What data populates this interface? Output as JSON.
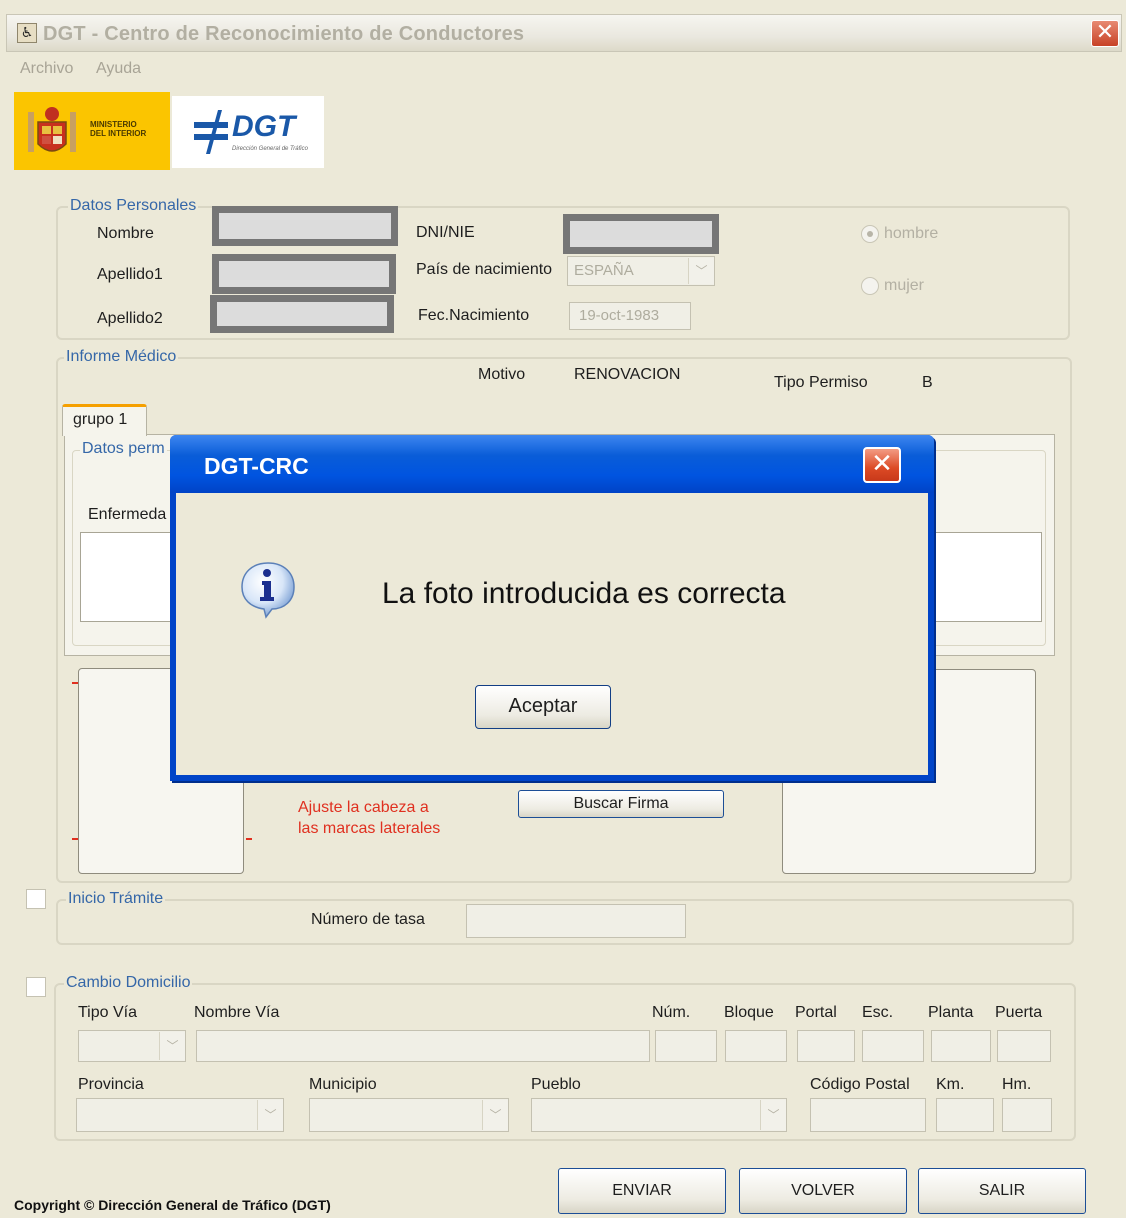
{
  "window": {
    "title": "DGT - Centro de Reconocimiento de Conductores",
    "close_glyph": "✕"
  },
  "menu": {
    "items": [
      "Archivo",
      "Ayuda"
    ]
  },
  "logos": {
    "ministerio_text": "MINISTERIO\nDEL INTERIOR",
    "dgt_text": "DGT",
    "dgt_subtitle": "Dirección General de Tráfico"
  },
  "datos_personales": {
    "legend": "Datos Personales",
    "nombre_label": "Nombre",
    "apellido1_label": "Apellido1",
    "apellido2_label": "Apellido2",
    "dni_label": "DNI/NIE",
    "pais_label": "País de nacimiento",
    "pais_value": "ESPAÑA",
    "fecha_label": "Fec.Nacimiento",
    "fecha_value": "19-oct-1983",
    "sexo_hombre": "hombre",
    "sexo_mujer": "mujer",
    "sexo_selected": "hombre"
  },
  "informe_medico": {
    "legend": "Informe Médico",
    "motivo_label": "Motivo",
    "motivo_value": "RENOVACION",
    "tipo_permiso_label": "Tipo Permiso",
    "tipo_permiso_value": "B",
    "tab_label": "grupo 1",
    "datos_permiso_label": "Datos perm",
    "enfermedad_label": "Enfermeda",
    "foto_hint": "Ajuste la cabeza a\nlas marcas laterales",
    "buscar_firma": "Buscar Firma"
  },
  "inicio_tramite": {
    "legend": "Inicio Trámite",
    "numero_tasa_label": "Número de tasa"
  },
  "cambio_domicilio": {
    "legend": "Cambio Domicilio",
    "tipo_via": "Tipo Vía",
    "nombre_via": "Nombre Vía",
    "num": "Núm.",
    "bloque": "Bloque",
    "portal": "Portal",
    "esc": "Esc.",
    "planta": "Planta",
    "puerta": "Puerta",
    "provincia": "Provincia",
    "municipio": "Municipio",
    "pueblo": "Pueblo",
    "codigo_postal": "Código Postal",
    "km": "Km.",
    "hm": "Hm."
  },
  "buttons": {
    "enviar": "ENVIAR",
    "volver": "VOLVER",
    "salir": "SALIR"
  },
  "copyright": "Copyright © Dirección General de Tráfico (DGT)",
  "dialog": {
    "title": "DGT-CRC",
    "message": "La foto introducida es correcta",
    "accept": "Aceptar",
    "icon": "info-icon"
  },
  "colors": {
    "legend_blue": "#3567A8",
    "dialog_blue": "#0054E0",
    "hint_red": "#E03020",
    "ministerio_yellow": "#FBC500",
    "dgt_blue": "#1A58A8"
  }
}
